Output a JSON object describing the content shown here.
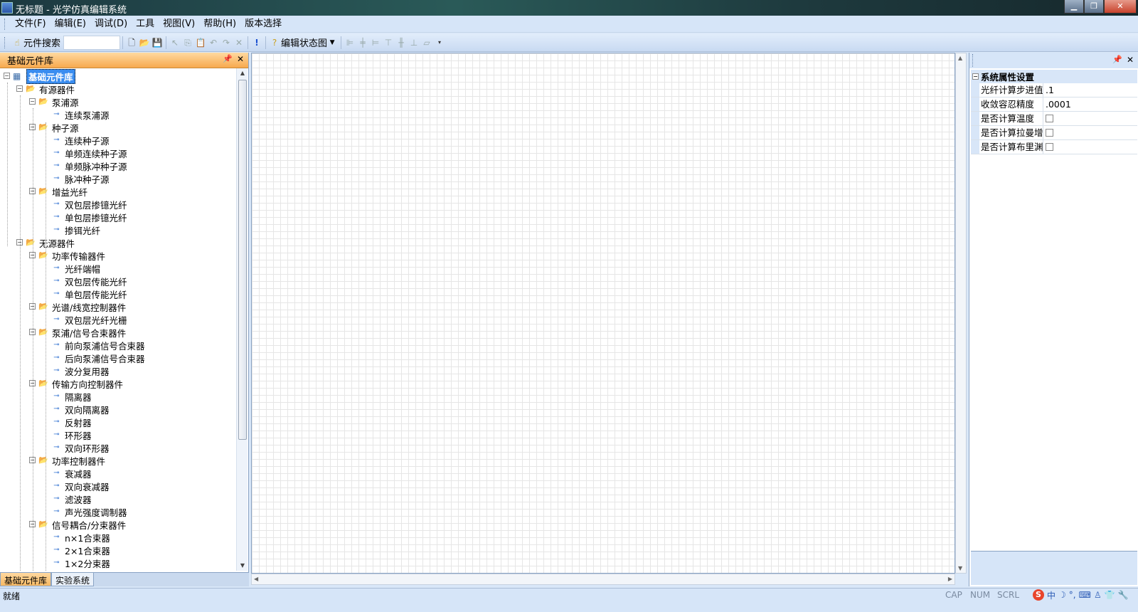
{
  "window": {
    "title": "无标题 - 光学仿真编辑系统",
    "app_icon": "app-icon"
  },
  "menu": [
    "文件(F)",
    "编辑(E)",
    "调试(D)",
    "工具",
    "视图(V)",
    "帮助(H)",
    "版本选择"
  ],
  "toolbar": {
    "search_label": "元件搜索",
    "search_value": "",
    "state_combo": "编辑状态图"
  },
  "left_pane": {
    "title": "基础元件库",
    "tabs": [
      "基础元件库",
      "实验系统"
    ],
    "tree": [
      {
        "label": "基础元件库",
        "level": 0,
        "type": "root",
        "selected": true
      },
      {
        "label": "有源器件",
        "level": 1,
        "type": "folder"
      },
      {
        "label": "泵浦源",
        "level": 2,
        "type": "folder"
      },
      {
        "label": "连续泵浦源",
        "level": 3,
        "type": "leaf"
      },
      {
        "label": "种子源",
        "level": 2,
        "type": "folder"
      },
      {
        "label": "连续种子源",
        "level": 3,
        "type": "leaf"
      },
      {
        "label": "单频连续种子源",
        "level": 3,
        "type": "leaf"
      },
      {
        "label": "单频脉冲种子源",
        "level": 3,
        "type": "leaf"
      },
      {
        "label": "脉冲种子源",
        "level": 3,
        "type": "leaf"
      },
      {
        "label": "增益光纤",
        "level": 2,
        "type": "folder"
      },
      {
        "label": "双包层掺镱光纤",
        "level": 3,
        "type": "leaf"
      },
      {
        "label": "单包层掺镱光纤",
        "level": 3,
        "type": "leaf"
      },
      {
        "label": "掺铒光纤",
        "level": 3,
        "type": "leaf"
      },
      {
        "label": "无源器件",
        "level": 1,
        "type": "folder"
      },
      {
        "label": "功率传输器件",
        "level": 2,
        "type": "folder"
      },
      {
        "label": "光纤端帽",
        "level": 3,
        "type": "leaf"
      },
      {
        "label": "双包层传能光纤",
        "level": 3,
        "type": "leaf"
      },
      {
        "label": "单包层传能光纤",
        "level": 3,
        "type": "leaf"
      },
      {
        "label": "光谱/线宽控制器件",
        "level": 2,
        "type": "folder"
      },
      {
        "label": "双包层光纤光栅",
        "level": 3,
        "type": "leaf"
      },
      {
        "label": "泵浦/信号合束器件",
        "level": 2,
        "type": "folder"
      },
      {
        "label": "前向泵浦信号合束器",
        "level": 3,
        "type": "leaf"
      },
      {
        "label": "后向泵浦信号合束器",
        "level": 3,
        "type": "leaf"
      },
      {
        "label": "波分复用器",
        "level": 3,
        "type": "leaf"
      },
      {
        "label": "传输方向控制器件",
        "level": 2,
        "type": "folder"
      },
      {
        "label": "隔离器",
        "level": 3,
        "type": "leaf"
      },
      {
        "label": "双向隔离器",
        "level": 3,
        "type": "leaf"
      },
      {
        "label": "反射器",
        "level": 3,
        "type": "leaf"
      },
      {
        "label": "环形器",
        "level": 3,
        "type": "leaf"
      },
      {
        "label": "双向环形器",
        "level": 3,
        "type": "leaf"
      },
      {
        "label": "功率控制器件",
        "level": 2,
        "type": "folder"
      },
      {
        "label": "衰减器",
        "level": 3,
        "type": "leaf"
      },
      {
        "label": "双向衰减器",
        "level": 3,
        "type": "leaf"
      },
      {
        "label": "滤波器",
        "level": 3,
        "type": "leaf"
      },
      {
        "label": "声光强度调制器",
        "level": 3,
        "type": "leaf"
      },
      {
        "label": "信号耦合/分束器件",
        "level": 2,
        "type": "folder"
      },
      {
        "label": "n×1合束器",
        "level": 3,
        "type": "leaf"
      },
      {
        "label": "2×1合束器",
        "level": 3,
        "type": "leaf"
      },
      {
        "label": "1×2分束器",
        "level": 3,
        "type": "leaf"
      }
    ]
  },
  "properties": {
    "category": "系统属性设置",
    "rows": [
      {
        "name": "光纤计算步进值",
        "value": ".1",
        "type": "text"
      },
      {
        "name": "收敛容忍精度",
        "value": ".0001",
        "type": "text"
      },
      {
        "name": "是否计算温度",
        "value": "",
        "type": "checkbox"
      },
      {
        "name": "是否计算拉曼增",
        "value": "",
        "type": "checkbox"
      },
      {
        "name": "是否计算布里渊",
        "value": "",
        "type": "checkbox"
      }
    ]
  },
  "status": {
    "text": "就绪",
    "indicators": [
      "CAP",
      "NUM",
      "SCRL"
    ],
    "ime": [
      "S",
      "中"
    ]
  }
}
